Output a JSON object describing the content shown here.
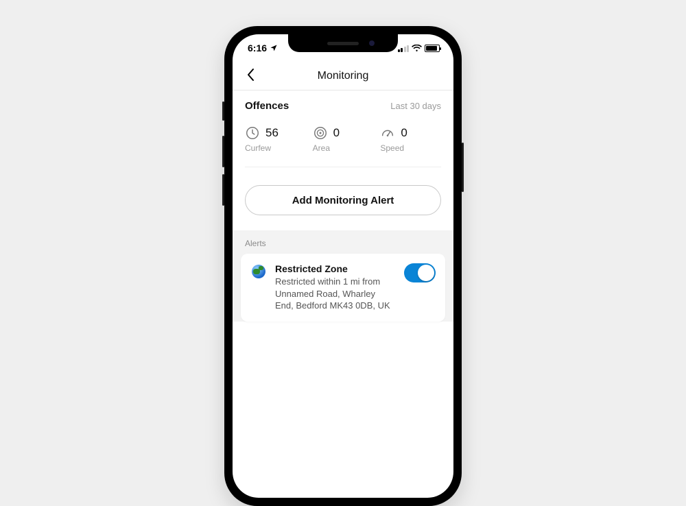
{
  "status": {
    "time": "6:16"
  },
  "nav": {
    "title": "Monitoring"
  },
  "offences": {
    "title": "Offences",
    "period": "Last 30 days",
    "stats": [
      {
        "label": "Curfew",
        "value": "56"
      },
      {
        "label": "Area",
        "value": "0"
      },
      {
        "label": "Speed",
        "value": "0"
      }
    ]
  },
  "actions": {
    "add_alert": "Add Monitoring Alert"
  },
  "alerts": {
    "section_label": "Alerts",
    "items": [
      {
        "title": "Restricted Zone",
        "description": "Restricted within 1 mi from Unnamed Road, Wharley End, Bedford MK43 0DB, UK",
        "enabled": true
      }
    ]
  }
}
